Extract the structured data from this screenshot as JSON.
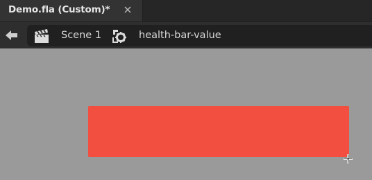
{
  "tab": {
    "title": "Demo.fla (Custom)*",
    "close_icon": "close-icon"
  },
  "editbar": {
    "back_icon": "back-arrow-icon",
    "crumbs": [
      {
        "icon": "scene-clapperboard-icon",
        "label": "Scene 1"
      },
      {
        "icon": "movieclip-symbol-icon",
        "label": "health-bar-value"
      }
    ]
  },
  "stage": {
    "background": "#9a9a9a",
    "shape_color": "#f34f40",
    "registration_icon": "registration-crosshair-icon"
  },
  "colors": {
    "tabbar_bg": "#262626",
    "active_tab_bg": "#333333",
    "editbar_bg": "#2e2e2e",
    "crumb_bg": "#202020",
    "text": "#d8d8d8"
  }
}
